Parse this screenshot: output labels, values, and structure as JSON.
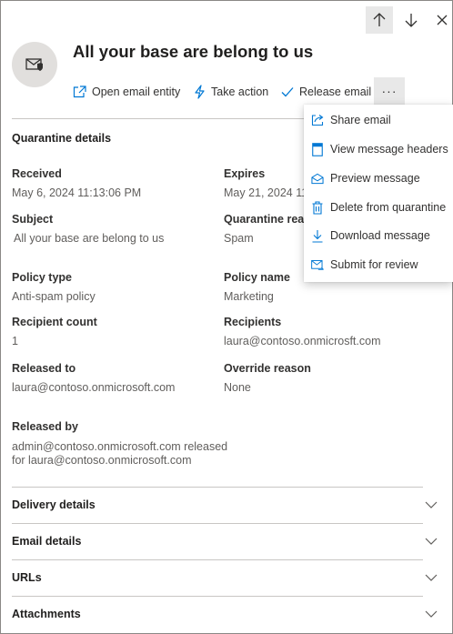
{
  "nav": {
    "up_icon": "arrow-up-icon",
    "down_icon": "arrow-down-icon",
    "close_icon": "close-icon"
  },
  "header": {
    "avatar_icon": "mail-shield-icon",
    "title": "All your base are belong to us",
    "actions": [
      {
        "label": "Open email entity",
        "icon": "open-external-icon"
      },
      {
        "label": "Take action",
        "icon": "lightning-icon"
      },
      {
        "label": "Release email",
        "icon": "checkmark-icon"
      }
    ],
    "more_label": "···",
    "more_icon": "more-icon"
  },
  "quarantine": {
    "title": "Quarantine details",
    "received_label": "Received",
    "received_value": "May 6, 2024 11:13:06 PM",
    "expires_label": "Expires",
    "expires_value": "May 21, 2024 11:",
    "subject_label": "Subject",
    "subject_value": "All your base are belong to us",
    "reason_label": "Quarantine reas",
    "reason_value": "Spam",
    "policy_type_label": "Policy type",
    "policy_type_value": "Anti-spam policy",
    "policy_name_label": "Policy name",
    "policy_name_value": "Marketing",
    "recipient_count_label": "Recipient count",
    "recipient_count_value": "1",
    "recipients_label": "Recipients",
    "recipients_value": "laura@contoso.onmicrosft.com",
    "released_to_label": "Released to",
    "released_to_value": "laura@contoso.onmicrosoft.com",
    "override_label": "Override reason",
    "override_value": "None",
    "released_by_label": "Released by",
    "released_by_value": "admin@contoso.onmicrosoft.com released for laura@contoso.onmicrosoft.com"
  },
  "sections": [
    {
      "label": "Delivery details"
    },
    {
      "label": "Email details"
    },
    {
      "label": "URLs"
    },
    {
      "label": "Attachments"
    }
  ],
  "menu": {
    "items": [
      {
        "label": "Share email",
        "icon": "share-icon"
      },
      {
        "label": "View message headers",
        "icon": "document-header-icon"
      },
      {
        "label": "Preview message",
        "icon": "mail-open-icon"
      },
      {
        "label": "Delete from quarantine",
        "icon": "trash-icon"
      },
      {
        "label": "Download message",
        "icon": "download-icon"
      },
      {
        "label": "Submit for review",
        "icon": "mail-submit-icon"
      }
    ]
  },
  "colors": {
    "accent": "#0078d4",
    "text": "#323130",
    "muted": "#605e5c",
    "divider": "#c8c6c4"
  }
}
